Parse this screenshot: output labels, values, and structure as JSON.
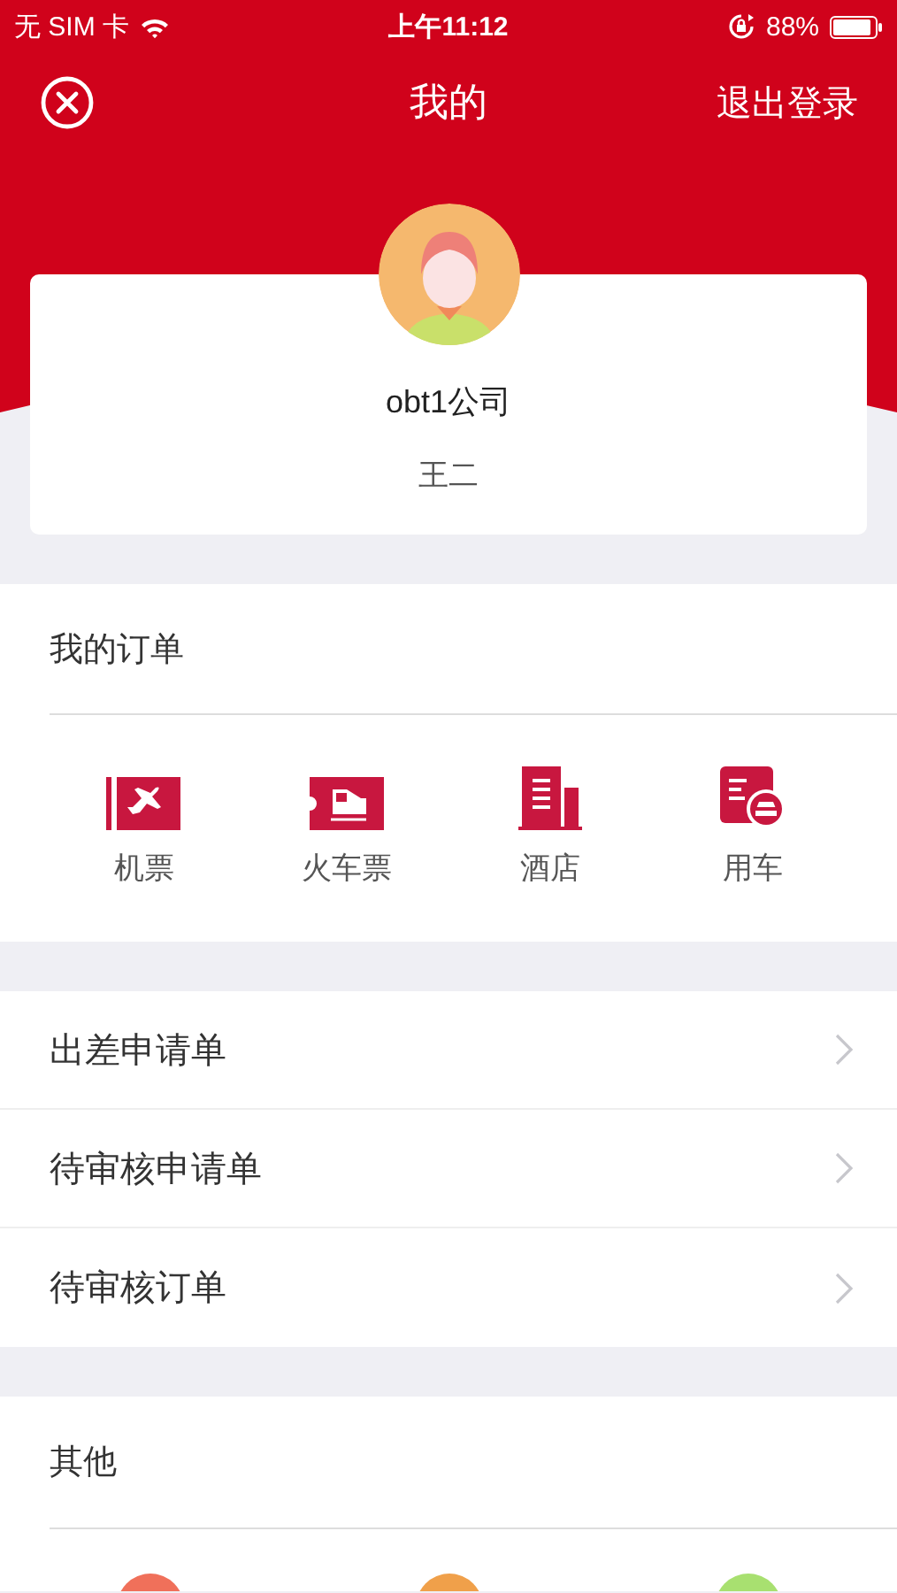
{
  "status_bar": {
    "carrier": "无 SIM 卡",
    "time": "上午11:12",
    "battery": "88%"
  },
  "nav": {
    "title": "我的",
    "logout": "退出登录"
  },
  "profile": {
    "company": "obt1公司",
    "name": "王二"
  },
  "orders": {
    "title": "我的订单",
    "items": [
      {
        "kind": "flight",
        "label": "机票"
      },
      {
        "kind": "train",
        "label": "火车票"
      },
      {
        "kind": "hotel",
        "label": "酒店"
      },
      {
        "kind": "car",
        "label": "用车"
      }
    ]
  },
  "menu": [
    {
      "label": "出差申请单"
    },
    {
      "label": "待审核申请单"
    },
    {
      "label": "待审核订单"
    }
  ],
  "other": {
    "title": "其他",
    "items": [
      {
        "color": "#f0705a"
      },
      {
        "color": "#f0a04a"
      },
      {
        "color": "#a8e070"
      }
    ]
  }
}
